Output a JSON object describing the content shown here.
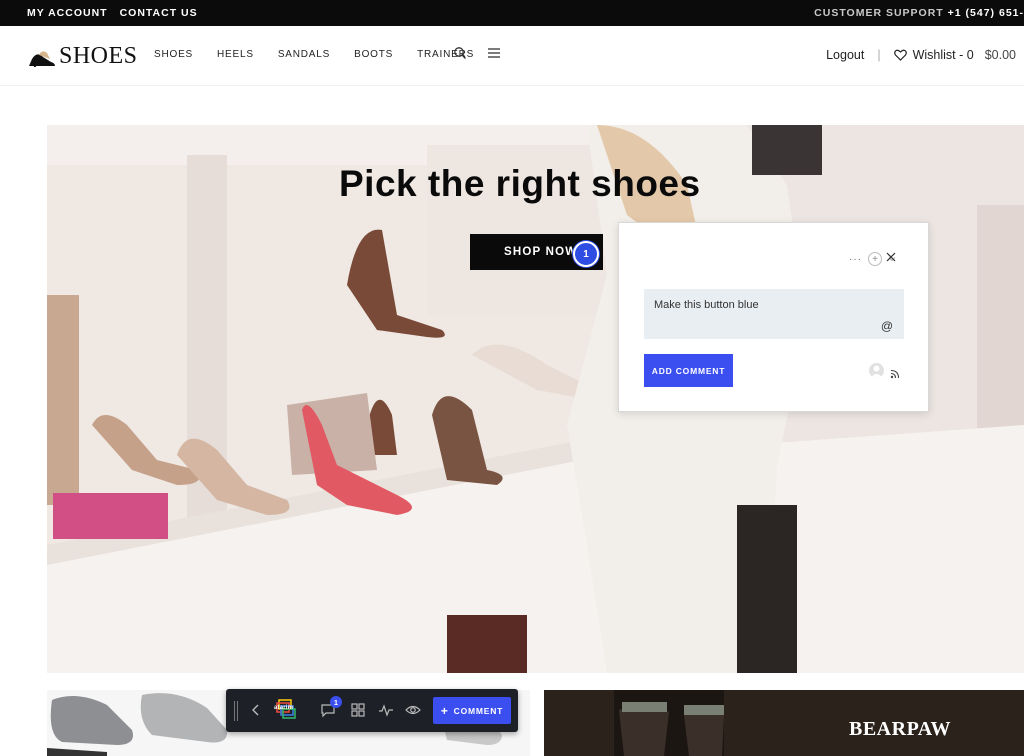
{
  "topbar": {
    "my_account": "MY ACCOUNT",
    "contact_us": "CONTACT US",
    "support_label": "CUSTOMER SUPPORT",
    "support_phone": "+1 (547) 651-"
  },
  "header": {
    "logo_text": "SHOES",
    "nav": [
      {
        "label": "SHOES"
      },
      {
        "label": "HEELS"
      },
      {
        "label": "SANDALS"
      },
      {
        "label": "BOOTS"
      },
      {
        "label": "TRAINERS"
      }
    ],
    "logout": "Logout",
    "wishlist": "Wishlist - 0",
    "cart_total": "$0.00"
  },
  "hero": {
    "title": "Pick the right shoes",
    "cta": "SHOP NOW",
    "pin_number": "1"
  },
  "comment_popup": {
    "text": "Make this button blue",
    "at_symbol": "@",
    "add_button": "ADD COMMENT",
    "more": "···",
    "plus": "+"
  },
  "toolbar": {
    "brand": "atarim",
    "badge_count": "1",
    "comment_button": "COMMENT",
    "comment_plus": "+"
  },
  "banner": {
    "brand": "BEARPAW"
  },
  "colors": {
    "accent_blue": "#3b4ef0",
    "topbar_bg": "#0b0b0b",
    "toolbar_bg": "#1d2026"
  }
}
